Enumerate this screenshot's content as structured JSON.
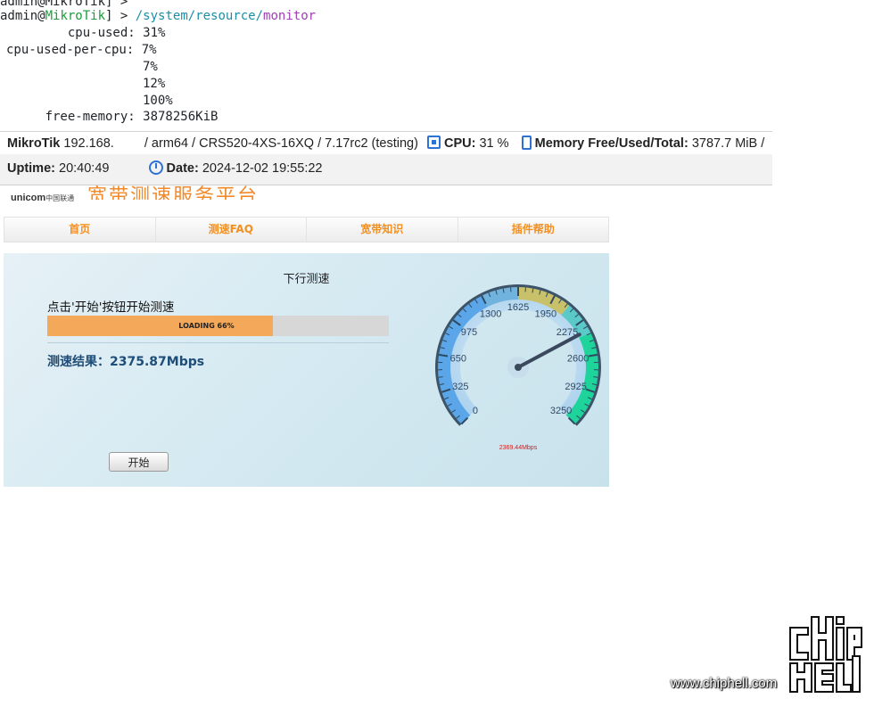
{
  "terminal": {
    "line0": "admin@MikroTik] >",
    "prompt_user": "admin",
    "prompt_at": "@",
    "prompt_host": "MikroTik",
    "prompt_tail": "] > ",
    "cmd_path": "/system/resource/",
    "cmd_action": "monitor",
    "cpu_used_label": "         cpu-used:",
    "cpu_used_value": " 31%",
    "per_cpu_label": "cpu-used-per-cpu:",
    "per_cpu_values": [
      " 7%",
      "7%",
      "12%",
      "100%"
    ],
    "free_mem_label": "      free-memory:",
    "free_mem_value": " 3878256KiB"
  },
  "statusbar": {
    "brand": "MikroTik",
    "ip": "192.168.",
    "system": "/ arm64 / CRS520-4XS-16XQ / 7.17rc2 (testing)",
    "cpu_label": "CPU:",
    "cpu_value": "31 %",
    "memory_label": "Memory Free/Used/Total:",
    "memory_value": "3787.7 MiB /",
    "uptime_label": "Uptime:",
    "uptime_value": "20:40:49",
    "date_label": "Date:",
    "date_value": "2024-12-02 19:55:22",
    "icons": [
      "cpu-chip-icon",
      "memory-icon",
      "clock-icon"
    ]
  },
  "speedtest": {
    "logo_main": "unicom",
    "logo_sub": "中国联通",
    "site_title": "宽带测速服务平台",
    "nav": [
      "首页",
      "测速FAQ",
      "宽带知识",
      "插件帮助"
    ],
    "panel_title": "下行测速",
    "hint": "点击'开始'按钮开始测速",
    "progress_fraction": 0.66,
    "progress_text": "LOADING 66%",
    "result": "测速结果：2375.87Mbps",
    "start_button": "开始",
    "gauge": {
      "ticks": [
        "0",
        "325",
        "650",
        "975",
        "1300",
        "1625",
        "1950",
        "2275",
        "2600",
        "2925",
        "3250"
      ],
      "min": 0,
      "max": 3250,
      "needle_value": 2369.44,
      "readout": "2369.44Mbps",
      "colors": {
        "low": "#5aa6e8",
        "high": "#1fd49a",
        "mid": "#c9c06a",
        "needle": "#3a4a5c",
        "readout": "#d21f1f"
      }
    },
    "colors": {
      "accent_orange": "#f39020",
      "result_blue": "#1e4d78",
      "bar_fill": "#f4a95a"
    }
  },
  "watermark": {
    "text": "www.chiphell.com",
    "logo": "chiphell"
  }
}
